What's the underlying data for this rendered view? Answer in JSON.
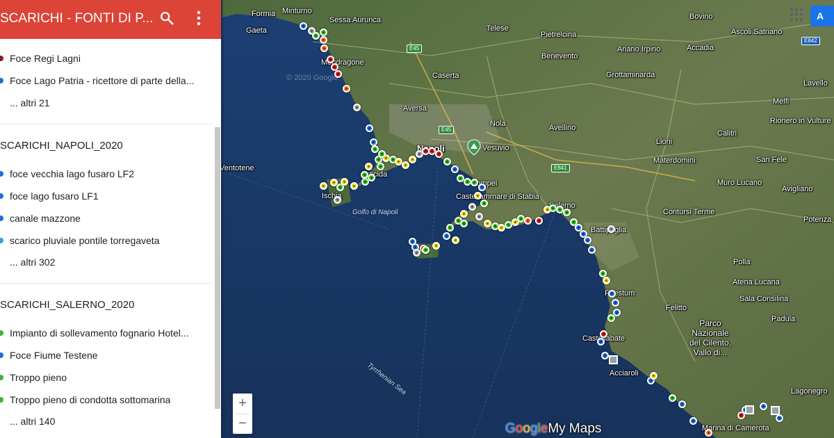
{
  "header": {
    "title": "SCARICHI - FONTI DI P...",
    "color": "#db4437",
    "search_icon": "search-icon",
    "menu_icon": "more-vert-icon"
  },
  "layers": [
    {
      "title": "",
      "features": [
        {
          "label": "Foce Regi Lagni",
          "color": "#8b1a1a"
        },
        {
          "label": "Foce Lago Patria - ricettore di parte della...",
          "color": "#1e6fd9"
        }
      ],
      "more": "... altri 21"
    },
    {
      "title": "SCARICHI_NAPOLI_2020",
      "features": [
        {
          "label": "foce vecchia lago fusaro LF2",
          "color": "#1e6fd9"
        },
        {
          "label": "foce lago fusaro LF1",
          "color": "#1e6fd9"
        },
        {
          "label": "canale mazzone",
          "color": "#1e6fd9"
        },
        {
          "label": "scarico pluviale pontile torregaveta",
          "color": "#29a8e0"
        }
      ],
      "more": "... altri 302"
    },
    {
      "title": "SCARICHI_SALERNO_2020",
      "features": [
        {
          "label": "Impianto di sollevamento fognario Hotel...",
          "color": "#3cb43c"
        },
        {
          "label": "Foce Fiume Testene",
          "color": "#1e6fd9"
        },
        {
          "label": "Troppo pieno",
          "color": "#3cb43c"
        },
        {
          "label": "Troppo pieno di condotta sottomarina",
          "color": "#3cb43c"
        }
      ],
      "more": "... altri 140"
    }
  ],
  "map": {
    "places": [
      {
        "name": "Formia",
        "big": false
      },
      {
        "name": "Minturno",
        "big": false
      },
      {
        "name": "Sessa Aurunca",
        "big": false
      },
      {
        "name": "Gaeta",
        "big": false
      },
      {
        "name": "Mondragone",
        "big": false
      },
      {
        "name": "Telese",
        "big": false
      },
      {
        "name": "Pietrelcina",
        "big": false
      },
      {
        "name": "Bovino",
        "big": false
      },
      {
        "name": "Ascoli Satriano",
        "big": false
      },
      {
        "name": "Benevento",
        "big": false
      },
      {
        "name": "Ariano Irpino",
        "big": false
      },
      {
        "name": "Accadia",
        "big": false
      },
      {
        "name": "Caserta",
        "big": false
      },
      {
        "name": "Grottaminarda",
        "big": false
      },
      {
        "name": "Lavello",
        "big": false
      },
      {
        "name": "Aversa",
        "big": false
      },
      {
        "name": "Nola",
        "big": false
      },
      {
        "name": "Avellino",
        "big": false
      },
      {
        "name": "Melfi",
        "big": false
      },
      {
        "name": "Rionero in Vulture",
        "big": false
      },
      {
        "name": "Calitri",
        "big": false
      },
      {
        "name": "Napoli",
        "big": true
      },
      {
        "name": "Vesuvio",
        "big": false
      },
      {
        "name": "Lioni",
        "big": false
      },
      {
        "name": "Materdomini",
        "big": false
      },
      {
        "name": "San Fele",
        "big": false
      },
      {
        "name": "Muro Lucano",
        "big": false
      },
      {
        "name": "Avigliano",
        "big": false
      },
      {
        "name": "Potenza",
        "big": false
      },
      {
        "name": "Contursi Terme",
        "big": false
      },
      {
        "name": "Salerno",
        "big": false
      },
      {
        "name": "Battipaglia",
        "big": false
      },
      {
        "name": "Castellammare di Stabia",
        "big": false
      },
      {
        "name": "Pompei",
        "big": false
      },
      {
        "name": "Ischia",
        "big": false
      },
      {
        "name": "Procida",
        "big": false
      },
      {
        "name": "Polla",
        "big": false
      },
      {
        "name": "Atena Lucana",
        "big": false
      },
      {
        "name": "Sala Consilina",
        "big": false
      },
      {
        "name": "Paestum",
        "big": false
      },
      {
        "name": "Felitto",
        "big": false
      },
      {
        "name": "Padula",
        "big": false
      },
      {
        "name": "Parco Nazionale del Cilento, Vallo di...",
        "big": false
      },
      {
        "name": "Castellabate",
        "big": false
      },
      {
        "name": "Acciaroli",
        "big": false
      },
      {
        "name": "Lagonegro",
        "big": false
      },
      {
        "name": "Marina di Camerota",
        "big": false
      },
      {
        "name": "Ventotene",
        "big": false
      }
    ],
    "seas": [
      "Golfo di Napoli",
      "Tyrrhenian Sea"
    ],
    "roads": [
      "E45",
      "E45",
      "E841",
      "E842"
    ],
    "watermark": "© 2020 Google",
    "marker_colors": {
      "blue": "#1e6fd9",
      "green": "#34c424",
      "yellow": "#f2e01a",
      "red": "#d11f1f",
      "orange": "#ff6a1f",
      "gray": "#a6a6a6",
      "darkred": "#8b1a1a"
    }
  },
  "controls": {
    "zoom_in": "+",
    "zoom_out": "−",
    "signin": "A",
    "apps_icon": "apps-grid-icon",
    "logo_google": [
      "G",
      "o",
      "o",
      "g",
      "l",
      "e"
    ],
    "logo_mymaps": "My Maps"
  }
}
